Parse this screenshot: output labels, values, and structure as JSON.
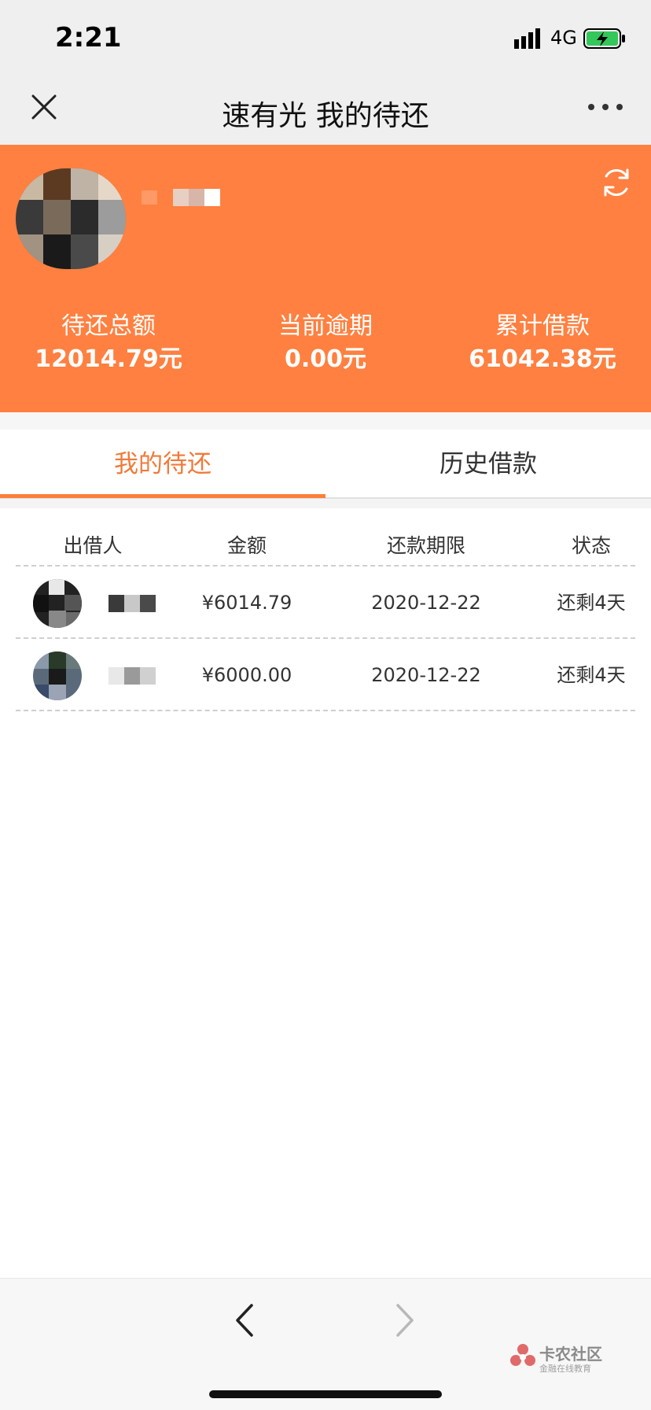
{
  "status_bar": {
    "time": "2:21",
    "network": "4G"
  },
  "nav": {
    "title": "速有光 我的待还"
  },
  "summary": {
    "pending_total_label": "待还总额",
    "pending_total_value": "12014.79元",
    "overdue_label": "当前逾期",
    "overdue_value": "0.00元",
    "cumulative_label": "累计借款",
    "cumulative_value": "61042.38元"
  },
  "tabs": [
    {
      "label": "我的待还",
      "active": true
    },
    {
      "label": "历史借款",
      "active": false
    }
  ],
  "table": {
    "headers": {
      "lender": "出借人",
      "amount": "金额",
      "due": "还款期限",
      "status": "状态"
    },
    "rows": [
      {
        "amount": "¥6014.79",
        "due": "2020-12-22",
        "status": "还剩4天"
      },
      {
        "amount": "¥6000.00",
        "due": "2020-12-22",
        "status": "还剩4天"
      }
    ]
  },
  "watermark": {
    "title": "卡农社区",
    "subtitle": "金融在线教育"
  },
  "colors": {
    "accent": "#ff8040",
    "tab_active": "#f07a3a"
  }
}
